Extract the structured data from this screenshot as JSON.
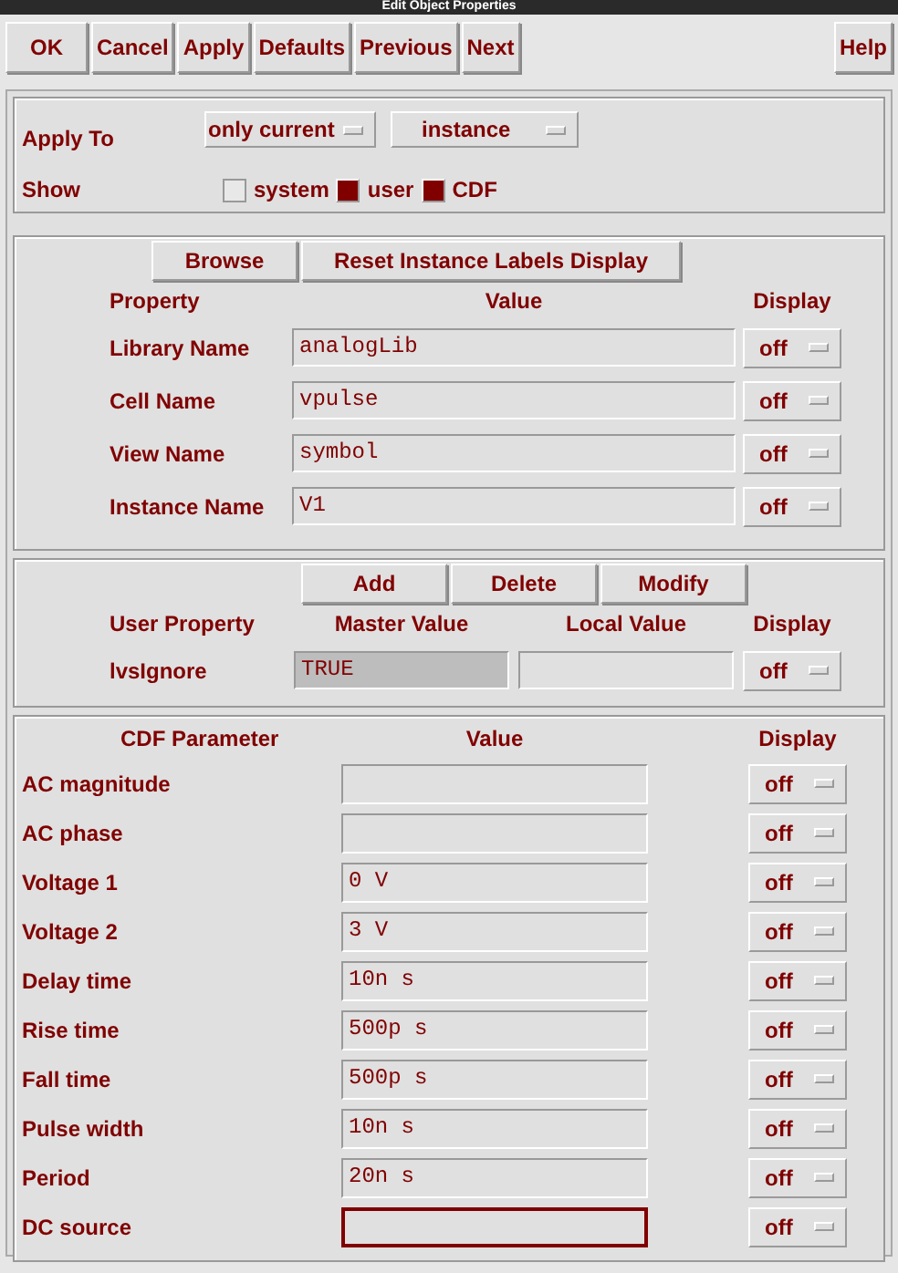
{
  "window": {
    "title": "Edit Object Properties"
  },
  "toolbar": {
    "buttons": [
      "OK",
      "Cancel",
      "Apply",
      "Defaults",
      "Previous",
      "Next"
    ],
    "help": "Help"
  },
  "apply_to": {
    "label": "Apply To",
    "options": [
      "only current",
      "instance"
    ]
  },
  "show": {
    "label": "Show",
    "items": [
      {
        "label": "system",
        "checked": false
      },
      {
        "label": "user",
        "checked": true
      },
      {
        "label": "CDF",
        "checked": true
      }
    ]
  },
  "properties": {
    "buttons": [
      "Browse",
      "Reset Instance Labels Display"
    ],
    "columns": [
      "Property",
      "Value",
      "Display"
    ],
    "rows": [
      {
        "name": "Library Name",
        "value": "analogLib",
        "display": "off"
      },
      {
        "name": "Cell Name",
        "value": "vpulse",
        "display": "off"
      },
      {
        "name": "View Name",
        "value": "symbol",
        "display": "off"
      },
      {
        "name": "Instance Name",
        "value": "V1",
        "display": "off"
      }
    ]
  },
  "user_properties": {
    "buttons": [
      "Add",
      "Delete",
      "Modify"
    ],
    "columns": [
      "User Property",
      "Master Value",
      "Local Value",
      "Display"
    ],
    "rows": [
      {
        "name": "lvsIgnore",
        "master_value": "TRUE",
        "display": "off"
      }
    ]
  },
  "cdf": {
    "columns": [
      "CDF Parameter",
      "Value",
      "Display"
    ],
    "rows": [
      {
        "name": "AC magnitude",
        "display": "off",
        "focused": false
      },
      {
        "name": "AC phase",
        "display": "off",
        "focused": false
      },
      {
        "name": "Voltage 1",
        "value": "0 V",
        "display": "off",
        "focused": false
      },
      {
        "name": "Voltage 2",
        "value": "3 V",
        "display": "off",
        "focused": false
      },
      {
        "name": "Delay time",
        "value": "10n s",
        "display": "off",
        "focused": false
      },
      {
        "name": "Rise time",
        "value": "500p s",
        "display": "off",
        "focused": false
      },
      {
        "name": "Fall time",
        "value": "500p s",
        "display": "off",
        "focused": false
      },
      {
        "name": "Pulse width",
        "value": "10n s",
        "display": "off",
        "focused": false
      },
      {
        "name": "Period",
        "value": "20n s",
        "display": "off",
        "focused": false
      },
      {
        "name": "DC source",
        "display": "off",
        "focused": true
      }
    ]
  }
}
